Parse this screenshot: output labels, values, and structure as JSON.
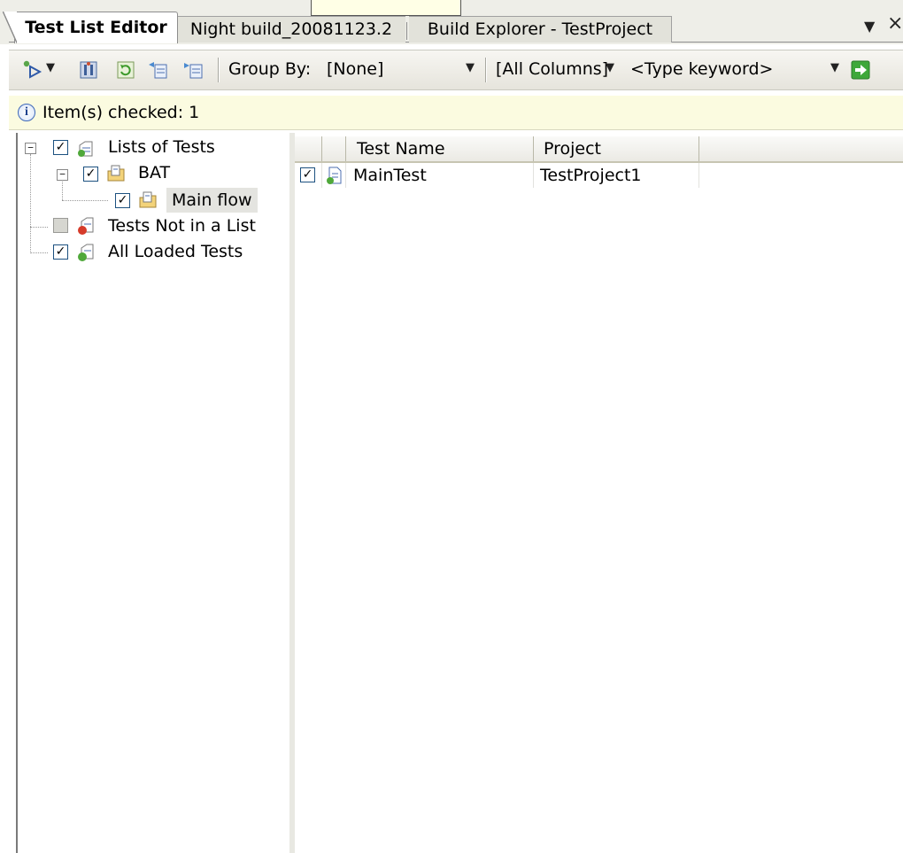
{
  "tabs": [
    {
      "label": "Test List Editor",
      "active": true
    },
    {
      "label": "Night build_20081123.2",
      "active": false
    },
    {
      "label": "Build Explorer - TestProject",
      "active": false
    }
  ],
  "toolbar": {
    "group_by_label": "Group By:",
    "group_by_value": "[None]",
    "columns_value": "[All Columns]",
    "keyword_placeholder": "<Type keyword>"
  },
  "infobar": {
    "message": "Item(s) checked: 1"
  },
  "tree": {
    "nodes": [
      {
        "label": "Lists of Tests",
        "checked": true,
        "expanded": true,
        "icon": "test-lists-icon"
      },
      {
        "label": "BAT",
        "checked": true,
        "expanded": true,
        "icon": "test-list-folder-icon"
      },
      {
        "label": "Main flow",
        "checked": true,
        "selected": true,
        "icon": "test-list-folder-icon"
      },
      {
        "label": "Tests Not in a List",
        "checked": false,
        "icon": "tests-not-in-list-icon"
      },
      {
        "label": "All Loaded Tests",
        "checked": true,
        "icon": "all-loaded-tests-icon"
      }
    ]
  },
  "grid": {
    "columns": [
      "Test Name",
      "Project"
    ],
    "rows": [
      {
        "checked": true,
        "test_name": "MainTest",
        "project": "TestProject1",
        "icon": "test-file-icon"
      }
    ]
  },
  "colors": {
    "infobar_bg": "#fbfbe0",
    "selected_bg": "#e4e4e0",
    "tab_strip_bg": "#eeeee8"
  }
}
